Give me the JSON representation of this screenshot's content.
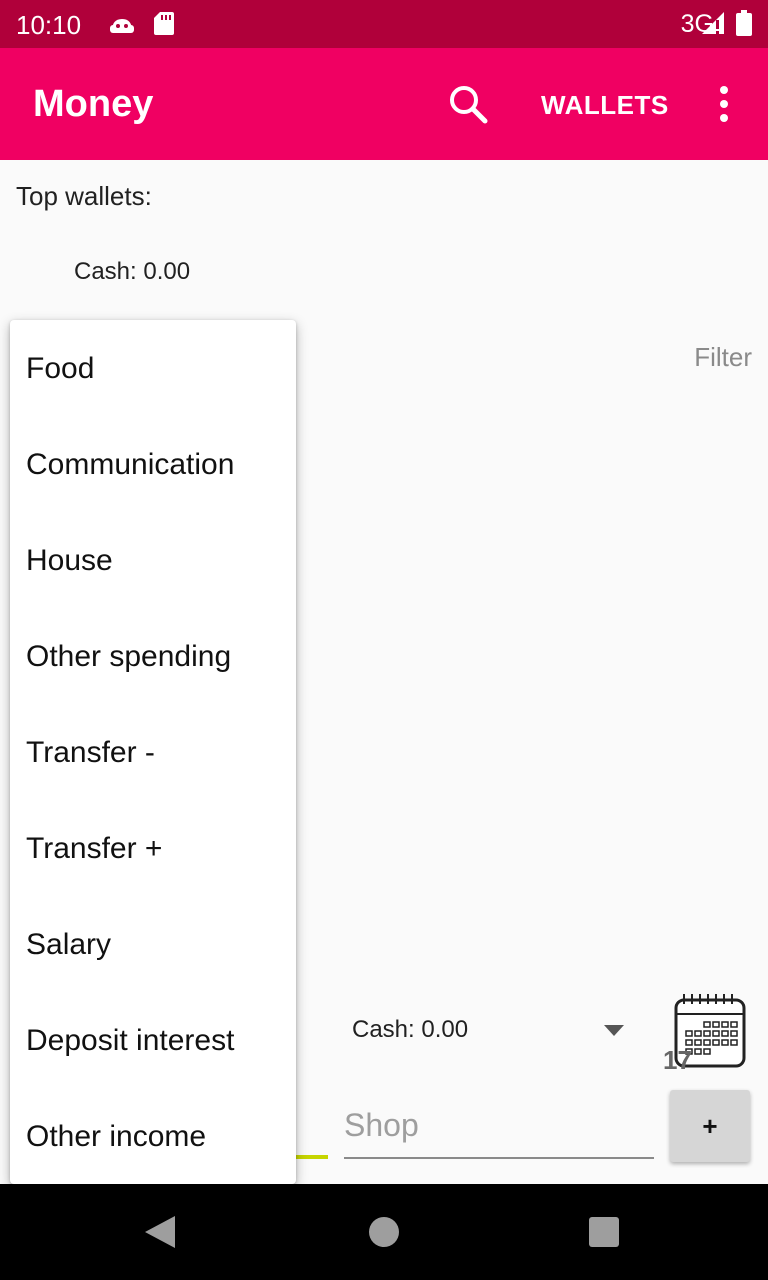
{
  "status_bar": {
    "time": "10:10",
    "network": "3G",
    "icons": [
      "android-icon",
      "sd-card-icon",
      "signal-icon",
      "battery-icon"
    ]
  },
  "appbar": {
    "title": "Money",
    "wallets_label": "WALLETS",
    "icons": [
      "search-icon",
      "more-vert-icon"
    ],
    "colors": {
      "appbar": "#f00062",
      "status_bar": "#b0003a"
    }
  },
  "main": {
    "top_wallets_label": "Top wallets:",
    "top_wallet_item": "Cash: 0.00",
    "filter_label": "Filter",
    "wallet_select": "Cash: 0.00",
    "calendar_day": "17",
    "shop_placeholder": "Shop",
    "add_button_label": "+"
  },
  "category_menu": {
    "items": [
      "Food",
      "Communication",
      "House",
      "Other spending",
      "Transfer -",
      "Transfer +",
      "Salary",
      "Deposit interest",
      "Other income"
    ]
  },
  "nav_bar": {
    "icons": [
      "back-icon",
      "home-icon",
      "recents-icon"
    ]
  }
}
